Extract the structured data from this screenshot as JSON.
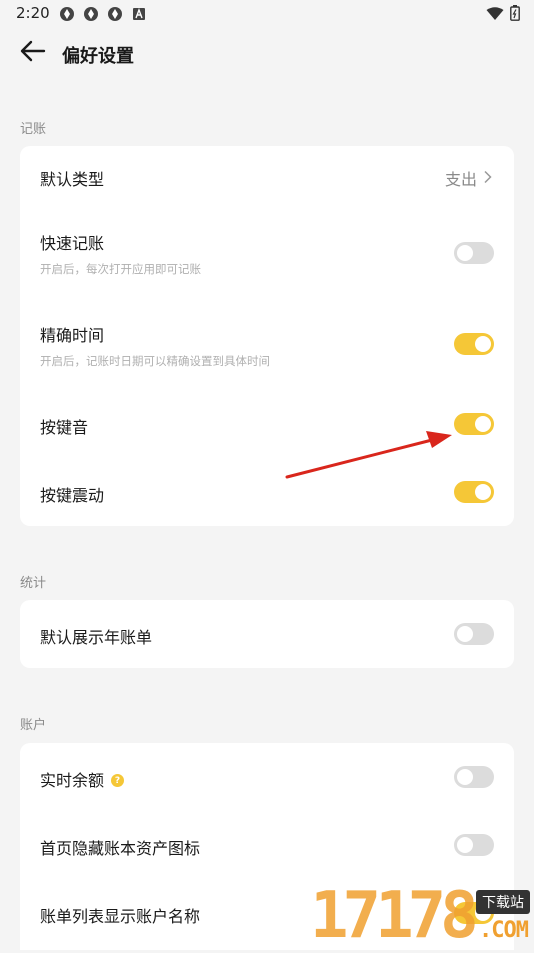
{
  "status_bar": {
    "time": "2:20",
    "icons": [
      "app-icon",
      "app-icon",
      "app-icon",
      "a-badge-icon"
    ],
    "right_icons": [
      "wifi-icon",
      "battery-icon"
    ]
  },
  "header": {
    "title": "偏好设置",
    "back_icon": "back-arrow-icon"
  },
  "sections": [
    {
      "label": "记账",
      "items": [
        {
          "label": "默认类型",
          "value": "支出",
          "type": "link"
        },
        {
          "label": "快速记账",
          "subtitle": "开启后，每次打开应用即可记账",
          "type": "toggle",
          "on": false
        },
        {
          "label": "精确时间",
          "subtitle": "开启后，记账时日期可以精确设置到具体时间",
          "type": "toggle",
          "on": true
        },
        {
          "label": "按键音",
          "type": "toggle",
          "on": true
        },
        {
          "label": "按键震动",
          "type": "toggle",
          "on": true
        }
      ]
    },
    {
      "label": "统计",
      "items": [
        {
          "label": "默认展示年账单",
          "type": "toggle",
          "on": false
        }
      ]
    },
    {
      "label": "账户",
      "items": [
        {
          "label": "实时余额",
          "type": "toggle",
          "on": false,
          "help": "?"
        },
        {
          "label": "首页隐藏账本资产图标",
          "type": "toggle",
          "on": false
        },
        {
          "label": "账单列表显示账户名称",
          "type": "toggle",
          "on": true
        }
      ]
    }
  ],
  "watermark": {
    "digits": "17178",
    "top_text": "下载站",
    "domain_text": ".COM"
  },
  "colors": {
    "accent": "#f5c737",
    "toggle_off": "#dcdcdc",
    "background": "#f4f4f4",
    "annotation_arrow": "#d9261c"
  }
}
